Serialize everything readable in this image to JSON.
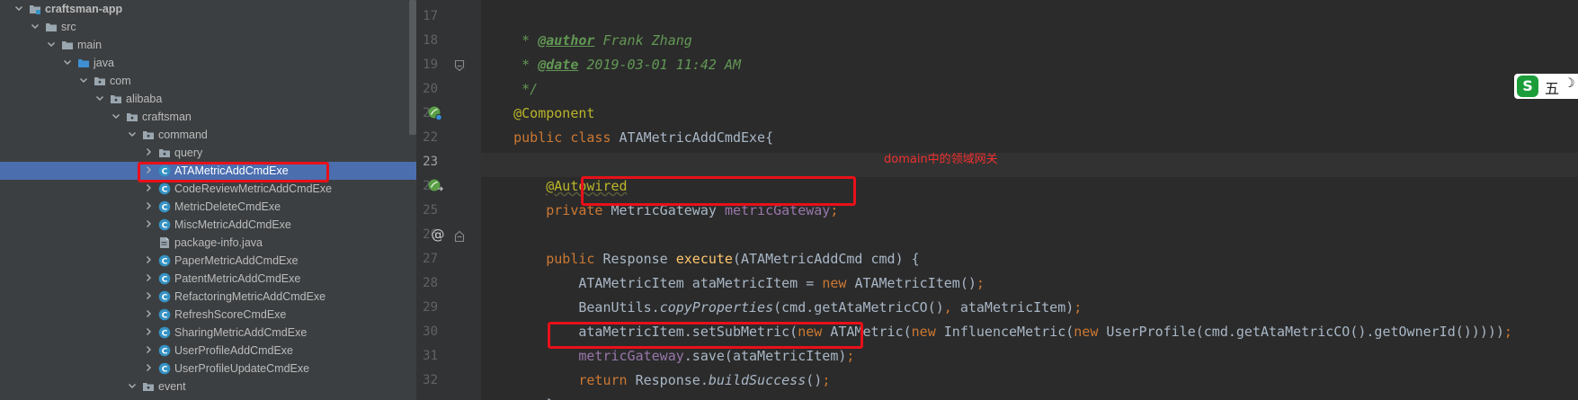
{
  "project_tree": {
    "items": [
      {
        "label": "craftsman-app",
        "icon": "module-folder-icon",
        "expanded": true
      },
      {
        "label": "src",
        "icon": "folder-icon",
        "expanded": true
      },
      {
        "label": "main",
        "icon": "folder-icon",
        "expanded": true
      },
      {
        "label": "java",
        "icon": "source-folder-icon",
        "expanded": true
      },
      {
        "label": "com",
        "icon": "package-icon",
        "expanded": true
      },
      {
        "label": "alibaba",
        "icon": "package-icon",
        "expanded": true
      },
      {
        "label": "craftsman",
        "icon": "package-icon",
        "expanded": true
      },
      {
        "label": "command",
        "icon": "package-icon",
        "expanded": true
      },
      {
        "label": "query",
        "icon": "package-icon",
        "expanded": false
      },
      {
        "label": "ATAMetricAddCmdExe",
        "icon": "class-icon",
        "expanded": false,
        "selected": true
      },
      {
        "label": "CodeReviewMetricAddCmdExe",
        "icon": "class-icon",
        "expanded": false
      },
      {
        "label": "MetricDeleteCmdExe",
        "icon": "class-icon",
        "expanded": false
      },
      {
        "label": "MiscMetricAddCmdExe",
        "icon": "class-icon",
        "expanded": false
      },
      {
        "label": "package-info.java",
        "icon": "java-file-icon"
      },
      {
        "label": "PaperMetricAddCmdExe",
        "icon": "class-icon",
        "expanded": false
      },
      {
        "label": "PatentMetricAddCmdExe",
        "icon": "class-icon",
        "expanded": false
      },
      {
        "label": "RefactoringMetricAddCmdExe",
        "icon": "class-icon",
        "expanded": false
      },
      {
        "label": "RefreshScoreCmdExe",
        "icon": "class-icon",
        "expanded": false
      },
      {
        "label": "SharingMetricAddCmdExe",
        "icon": "class-icon",
        "expanded": false
      },
      {
        "label": "UserProfileAddCmdExe",
        "icon": "class-icon",
        "expanded": false
      },
      {
        "label": "UserProfileUpdateCmdExe",
        "icon": "class-icon",
        "expanded": false
      },
      {
        "label": "event",
        "icon": "package-icon",
        "expanded": true
      }
    ]
  },
  "editor": {
    "current_line": "23",
    "lines": [
      {
        "num": "17",
        "gutter": ""
      },
      {
        "num": "18",
        "gutter": ""
      },
      {
        "num": "19",
        "gutter": "fold-end-icon"
      },
      {
        "num": "20",
        "gutter": ""
      },
      {
        "num": "21",
        "gutter": "bean-gutter-icon"
      },
      {
        "num": "22",
        "gutter": ""
      },
      {
        "num": "23",
        "gutter": ""
      },
      {
        "num": "24",
        "gutter": "bean-autowire-gutter-icon"
      },
      {
        "num": "25",
        "gutter": ""
      },
      {
        "num": "26",
        "gutter": "override-at-icon"
      },
      {
        "num": "27",
        "gutter": ""
      },
      {
        "num": "28",
        "gutter": ""
      },
      {
        "num": "29",
        "gutter": ""
      },
      {
        "num": "30",
        "gutter": ""
      },
      {
        "num": "31",
        "gutter": ""
      },
      {
        "num": "32",
        "gutter": ""
      }
    ],
    "tokens": {
      "l17_star": " * ",
      "l17_tag": "@author",
      "l17_text": " Frank Zhang",
      "l18_star": " * ",
      "l18_tag": "@date",
      "l18_text": " 2019-03-01 11:42 AM",
      "l19": " */",
      "l20": "@Component",
      "l21_public": "public ",
      "l21_class": "class ",
      "l21_name": "ATAMetricAddCmdExe{",
      "l23_indent": "    ",
      "l23_ann": "@Autowired",
      "l24_indent": "    ",
      "l24_private": "private ",
      "l24_type": "MetricGateway ",
      "l24_field": "metricGateway",
      "l24_semi": ";",
      "l26_indent": "    ",
      "l26_public": "public ",
      "l26_type": "Response ",
      "l26_method": "execute",
      "l26_rest": "(ATAMetricAddCmd cmd) {",
      "l27_indent": "        ",
      "l27_a": "ATAMetricItem ataMetricItem = ",
      "l27_new": "new ",
      "l27_b": "ATAMetricItem()",
      "l27_semi": ";",
      "l28_indent": "        ",
      "l28_a": "BeanUtils.",
      "l28_method": "copyProperties",
      "l28_b": "(cmd.getAtaMetricCO()",
      "l28_comma": ", ",
      "l28_c": "ataMetricItem)",
      "l28_semi": ";",
      "l29_indent": "        ",
      "l29_a": "ataMetricItem.setSubMetric(",
      "l29_new1": "new ",
      "l29_b": "ATAMetric(",
      "l29_new2": "new ",
      "l29_c": "InfluenceMetric(",
      "l29_new3": "new ",
      "l29_d": "UserProfile(cmd.getAtaMetricCO().getOwnerId()))))",
      "l29_semi": ";",
      "l30_indent": "        ",
      "l30_field": "metricGateway",
      "l30_b": ".save(ataMetricItem)",
      "l30_semi": ";",
      "l31_indent": "        ",
      "l31_return": "return ",
      "l31_a": "Response.",
      "l31_method": "buildSuccess",
      "l31_b": "()",
      "l31_semi": ";",
      "l32": "    }"
    }
  },
  "annotation_note": "domain中的领域网关",
  "ime": {
    "logo": "S",
    "char": "五",
    "moon": "☽"
  },
  "colors": {
    "tree_bg": "#3c3f41",
    "selected_row": "#4b6eaf",
    "editor_bg": "#2b2b2b",
    "keyword": "#cc7832",
    "annotation": "#bbb529",
    "field": "#9876aa",
    "method": "#ffc66d",
    "comment": "#629755",
    "highlight_box": "#e8101a"
  }
}
